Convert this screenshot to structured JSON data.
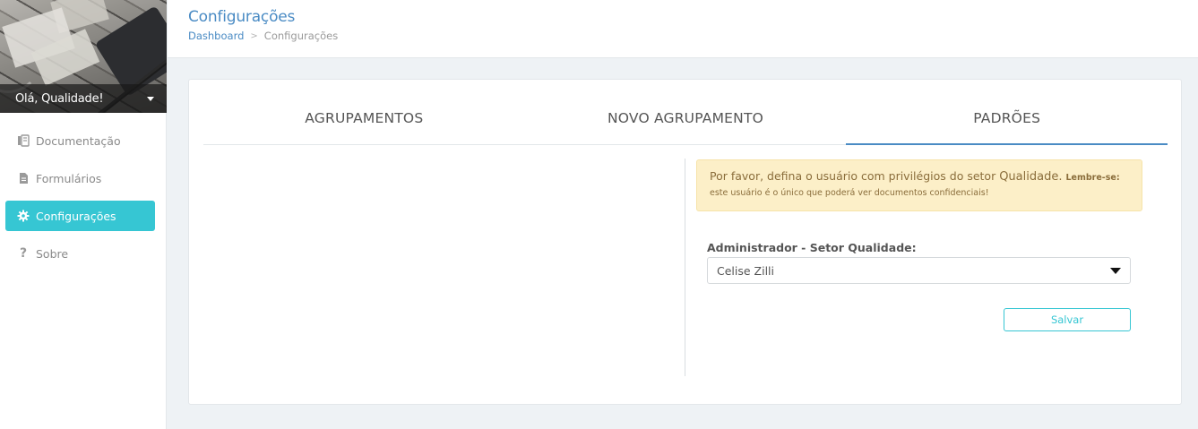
{
  "sidebar": {
    "greeting": "Olá, Qualidade!",
    "items": [
      {
        "label": "Documentação",
        "icon": "book-icon"
      },
      {
        "label": "Formulários",
        "icon": "file-icon"
      },
      {
        "label": "Configurações",
        "icon": "gear-icon",
        "active": true
      },
      {
        "label": "Sobre",
        "icon": "question-icon"
      }
    ]
  },
  "header": {
    "title": "Configurações",
    "breadcrumb": {
      "home": "Dashboard",
      "separator": ">",
      "current": "Configurações"
    }
  },
  "tabs": [
    {
      "label": "AGRUPAMENTOS"
    },
    {
      "label": "NOVO AGRUPAMENTO"
    },
    {
      "label": "PADRÕES",
      "active": true
    }
  ],
  "alert": {
    "text_prefix": "Por favor, defina o usuário com privilégios do setor",
    "text_strong": "Qualidade.",
    "text_lembre": "Lembre-se:",
    "text_line2": "este usuário é o único que poderá ver documentos confidenciais!"
  },
  "form": {
    "label": "Administrador - Setor Qualidade:",
    "selected_value": "Celise Zilli",
    "save_label": "Salvar"
  },
  "colors": {
    "accent": "#36c6d3",
    "link": "#4a8bc4",
    "alert_bg": "#fcefc8"
  }
}
